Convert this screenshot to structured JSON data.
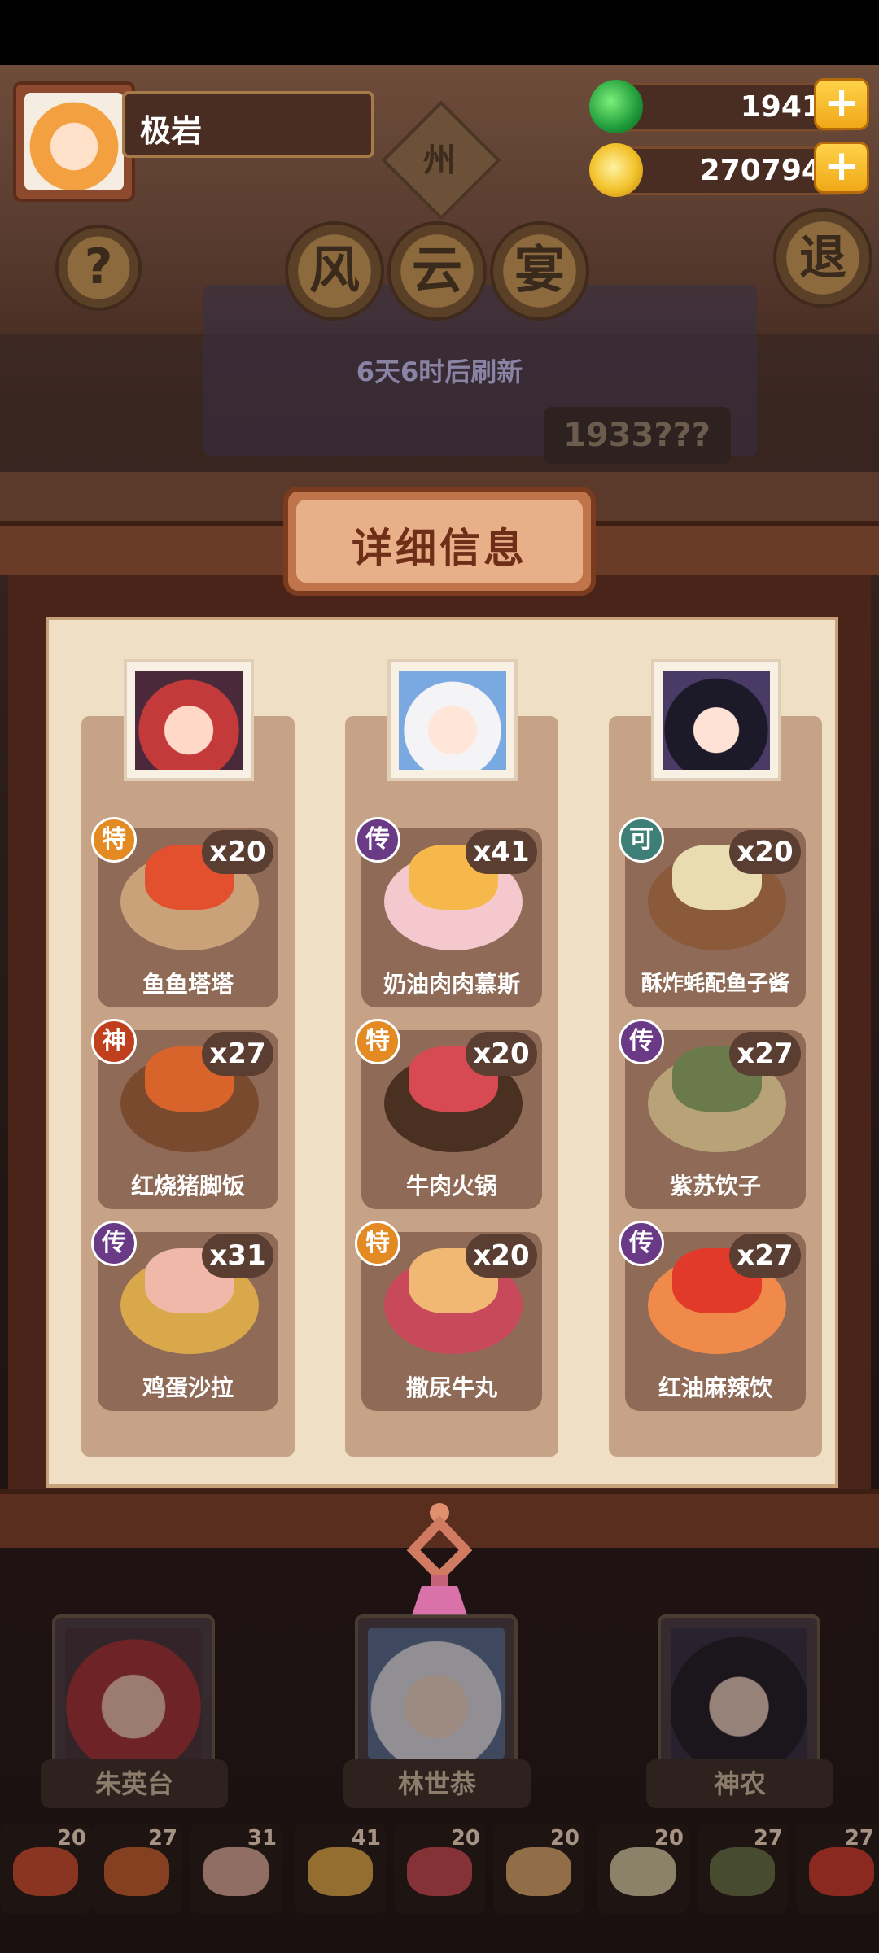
{
  "player": {
    "name": "极岩"
  },
  "currency": {
    "jade": "19411",
    "coins": "2707945"
  },
  "plus_label": "+",
  "header": {
    "help_label": "?",
    "sign_label": "州",
    "title_chars": [
      "风",
      "云",
      "宴"
    ],
    "exit_label": "退",
    "refresh_text": "6天6时后刷新",
    "score_text": "1933???"
  },
  "panel": {
    "title": "详细信息",
    "columns": [
      {
        "dishes": [
          {
            "badge": "特",
            "count": "x20",
            "name": "鱼鱼塔塔"
          },
          {
            "badge": "神",
            "count": "x27",
            "name": "红烧猪脚饭"
          },
          {
            "badge": "传",
            "count": "x31",
            "name": "鸡蛋沙拉"
          }
        ]
      },
      {
        "dishes": [
          {
            "badge": "传",
            "count": "x41",
            "name": "奶油肉肉慕斯"
          },
          {
            "badge": "特",
            "count": "x20",
            "name": "牛肉火锅"
          },
          {
            "badge": "特",
            "count": "x20",
            "name": "撒尿牛丸"
          }
        ]
      },
      {
        "dishes": [
          {
            "badge": "可",
            "count": "x20",
            "name": "酥炸蚝配鱼子酱"
          },
          {
            "badge": "传",
            "count": "x27",
            "name": "紫苏饮子"
          },
          {
            "badge": "传",
            "count": "x27",
            "name": "红油麻辣饮"
          }
        ]
      }
    ]
  },
  "characters": [
    {
      "name": "朱英台"
    },
    {
      "name": "林世恭"
    },
    {
      "name": "神农"
    }
  ],
  "dish_strip": [
    "20",
    "27",
    "31",
    "41",
    "20",
    "20",
    "20",
    "27",
    "27"
  ],
  "colors": {
    "badge_te": "#e38a22",
    "badge_chuan": "#6a3a86",
    "badge_shen": "#c0401e",
    "badge_ke": "#3e7f78"
  }
}
